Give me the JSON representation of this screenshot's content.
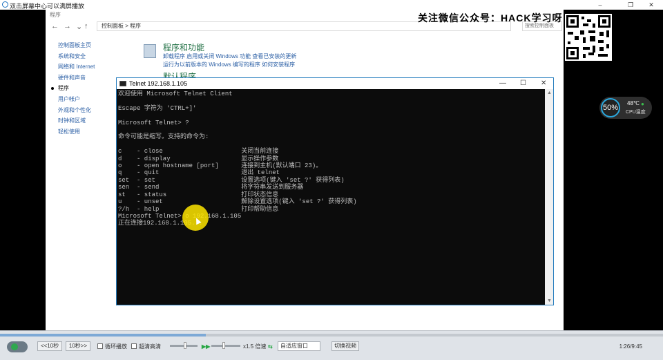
{
  "player": {
    "title": "双击屏幕中心可以满屏播放",
    "controls": {
      "back_label": "<<10秒",
      "forward_label": "10秒>>",
      "loop_label": "循环播放",
      "hq_label": "超清高清",
      "speed_label": "x1.5 倍速",
      "window_select": "自适应窗口",
      "switch_label": "切换视频",
      "time": "1:26/9:45",
      "seek_progress": 0.31
    }
  },
  "overlay": {
    "promo_text": "关注微信公众号：HACK学习呀"
  },
  "cpu_widget": {
    "percent": "50%",
    "temp": "48℃",
    "label": "CPU温度"
  },
  "control_panel": {
    "window_title": "程序",
    "breadcrumb": "控制面板 > 程序",
    "search_placeholder": "搜索控制面板",
    "sidebar": [
      "控制面板主页",
      "系统和安全",
      "网络和 Internet",
      "硬件和声音",
      "程序",
      "用户帐户",
      "外观和个性化",
      "时钟和区域",
      "轻松使用"
    ],
    "section1_title": "程序和功能",
    "section1_links_line1": "卸载程序   启用或关闭 Windows 功能   查看已安装的更新",
    "section1_links_line2": "运行为以前版本的 Windows 编写的程序   如何安装程序",
    "section2_title": "默认程序"
  },
  "telnet": {
    "title": "Telnet 192.168.1.105",
    "lines": [
      "欢迎使用 Microsoft Telnet Client",
      "",
      "Escape 字符为 'CTRL+]'",
      "",
      "Microsoft Telnet> ?",
      "",
      "命令可能是缩写。支持的命令为:",
      "",
      "c    - close                     关闭当前连接",
      "d    - display                   显示操作参数",
      "o    - open hostname [port]      连接到主机(默认端口 23)。",
      "q    - quit                      退出 telnet",
      "set  - set                       设置选项(键入 'set ?' 获得列表)",
      "sen  - send                      将字符串发送到服务器",
      "st   - status                    打印状态信息",
      "u    - unset                     解除设置选项(键入 'set ?' 获得列表)",
      "?/h  - help                      打印帮助信息",
      "Microsoft Telnet> o 192.168.1.105",
      "正在连接192.168.1.105..."
    ]
  },
  "colors": {
    "telnet_bg": "#0c0c0c",
    "accent": "#2a7fbf",
    "highlight": "#ffe600"
  }
}
